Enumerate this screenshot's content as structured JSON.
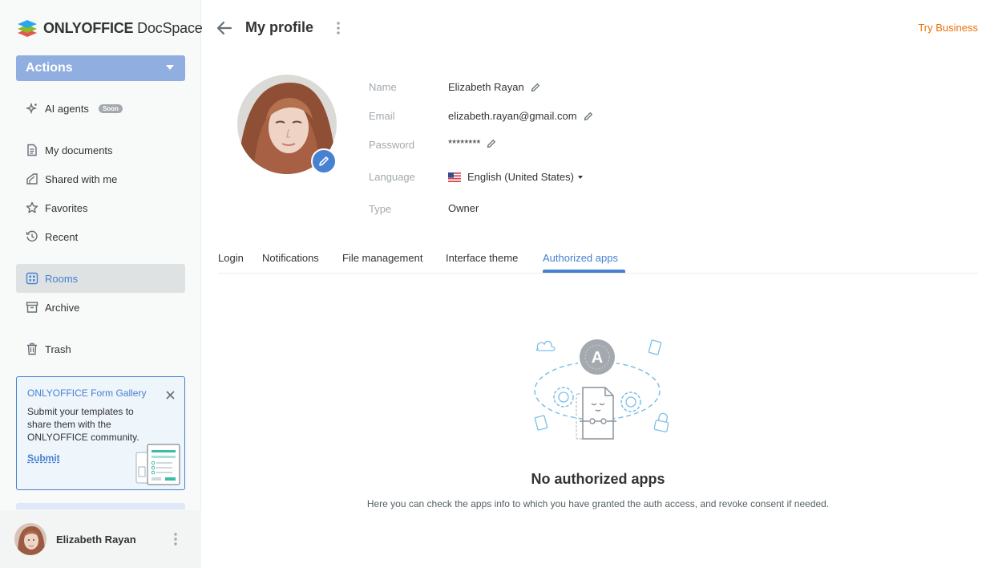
{
  "brand": {
    "name_bold": "ONLYOFFICE",
    "name_light": " DocSpace"
  },
  "sidebar": {
    "actions_label": "Actions",
    "items": [
      {
        "label": "AI agents",
        "icon": "ai-agents-icon",
        "badge": "Soon"
      },
      {
        "label": "My documents",
        "icon": "document-icon"
      },
      {
        "label": "Shared with me",
        "icon": "shared-icon"
      },
      {
        "label": "Favorites",
        "icon": "star-icon"
      },
      {
        "label": "Recent",
        "icon": "clock-icon"
      },
      {
        "label": "Rooms",
        "icon": "rooms-icon",
        "active": true
      },
      {
        "label": "Archive",
        "icon": "archive-icon"
      },
      {
        "label": "Trash",
        "icon": "trash-icon"
      }
    ],
    "gallery": {
      "title": "ONLYOFFICE Form Gallery",
      "text": "Submit your templates to share them with the ONLYOFFICE community.",
      "submit": "Submit"
    },
    "user": {
      "name": "Elizabeth Rayan"
    }
  },
  "header": {
    "title": "My profile",
    "try_business": "Try Business"
  },
  "profile": {
    "name_label": "Name",
    "name": "Elizabeth Rayan",
    "email_label": "Email",
    "email": "elizabeth.rayan@gmail.com",
    "password_label": "Password",
    "password": "********",
    "language_label": "Language",
    "language": "English (United States)",
    "type_label": "Type",
    "type": "Owner"
  },
  "tabs": [
    {
      "label": "Login"
    },
    {
      "label": "Notifications"
    },
    {
      "label": "File management"
    },
    {
      "label": "Interface theme"
    },
    {
      "label": "Authorized apps",
      "active": true
    }
  ],
  "empty": {
    "icon_letter": "A",
    "title": "No authorized apps",
    "description": "Here you can check the apps info to which you have granted the auth access, and revoke consent if needed."
  },
  "colors": {
    "accent": "#4781d1",
    "actions_button": "#90aee0",
    "try_business": "#ed7309",
    "active_nav_bg": "#dfe2e3"
  }
}
